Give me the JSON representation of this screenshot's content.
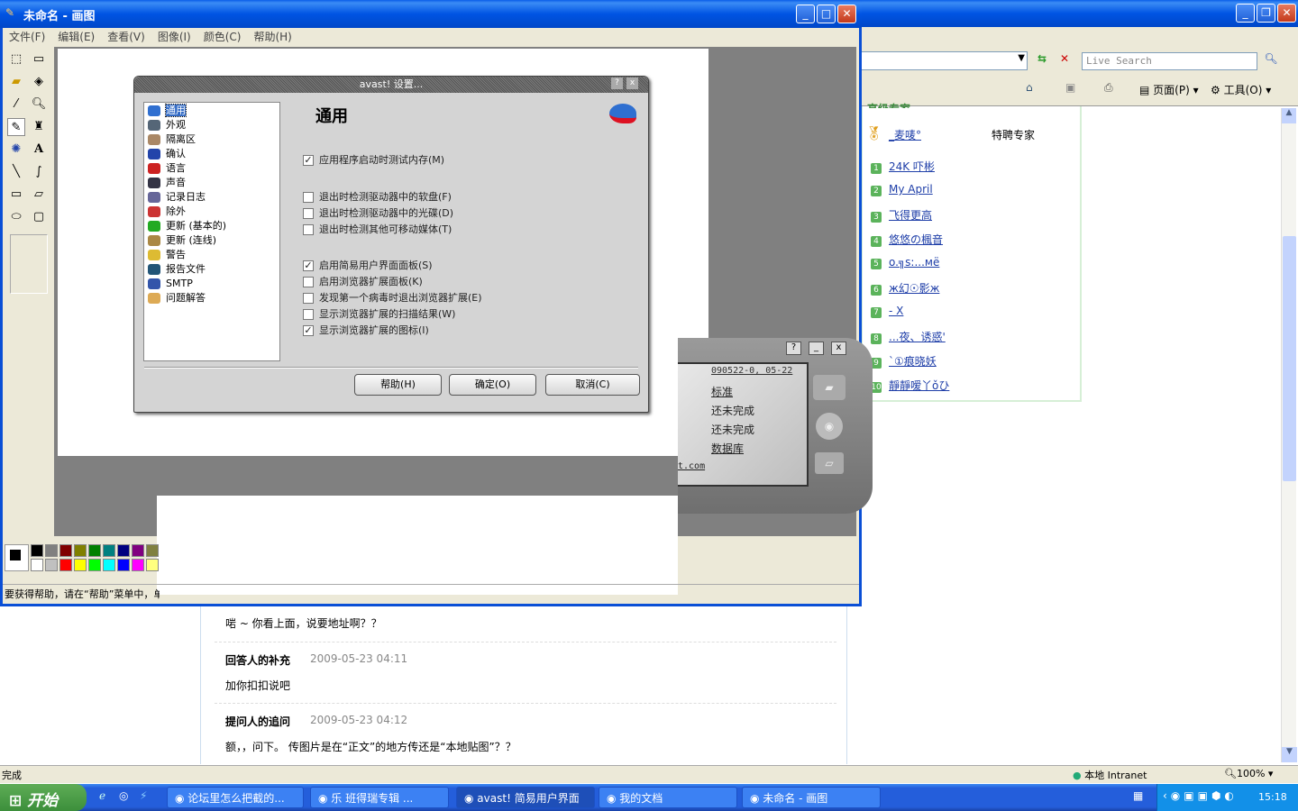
{
  "ie": {
    "live_search_placeholder": "Live Search",
    "page_menu": "页面(P)",
    "tools_menu": "工具(O)",
    "status_done": "完成",
    "zone": "本地 Intranet",
    "zoom": "100%",
    "ranking": {
      "partial_heading": "高级专家",
      "top_user": "_麦唛°",
      "top_role": "特聘专家",
      "items": [
        {
          "n": "1",
          "name": "24K 吓彬"
        },
        {
          "n": "2",
          "name": "My April"
        },
        {
          "n": "3",
          "name": "飞得更高"
        },
        {
          "n": "4",
          "name": "悠悠の楓音"
        },
        {
          "n": "5",
          "name": "o.╗s:...мё"
        },
        {
          "n": "6",
          "name": "ж幻☉影ж"
        },
        {
          "n": "7",
          "name": "- X"
        },
        {
          "n": "8",
          "name": "...夜、诱惑'"
        },
        {
          "n": "9",
          "name": "`①痕晓妖"
        },
        {
          "n": "10",
          "name": "靜靜嗳丫ǒひ"
        }
      ]
    },
    "thread": {
      "line0": "啱 ~ 你看上面，说要地址啊？？",
      "posts": [
        {
          "label": "回答人的补充",
          "time": "2009-05-23 04:11",
          "text": "加你扣扣说吧"
        },
        {
          "label": "提问人的追问",
          "time": "2009-05-23 04:12",
          "text": "额，，问下。 传图片是在“正文”的地方传还是“本地贴图”？？"
        }
      ]
    }
  },
  "paint": {
    "title": "未命名 - 画图",
    "menus": [
      "文件(F)",
      "编辑(E)",
      "查看(V)",
      "图像(I)",
      "颜色(C)",
      "帮助(H)"
    ],
    "status": "要获得帮助，请在“帮助”菜单中，单击“帮助主题”。",
    "palette_top": [
      "#000000",
      "#808080",
      "#800000",
      "#808000",
      "#008000",
      "#008080",
      "#000080",
      "#800080",
      "#808040"
    ],
    "palette_bottom": [
      "#ffffff",
      "#c0c0c0",
      "#ff0000",
      "#ffff00",
      "#00ff00",
      "#00ffff",
      "#0000ff",
      "#ff00ff",
      "#ffff80"
    ]
  },
  "avast": {
    "title": "avast! 设置...",
    "heading": "通用",
    "tree": [
      "通用",
      "外观",
      "隔离区",
      "确认",
      "语言",
      "声音",
      "记录日志",
      "除外",
      "更新 (基本的)",
      "更新 (连线)",
      "警告",
      "报告文件",
      "SMTP",
      "问题解答"
    ],
    "options": [
      {
        "label": "应用程序启动时测试内存(M)",
        "checked": true
      },
      {
        "label": "退出时检测驱动器中的软盘(F)",
        "checked": false
      },
      {
        "label": "退出时检测驱动器中的光碟(D)",
        "checked": false
      },
      {
        "label": "退出时检测其他可移动媒体(T)",
        "checked": false
      },
      {
        "label": "启用简易用户界面面板(S)",
        "checked": true
      },
      {
        "label": "启用浏览器扩展面板(K)",
        "checked": false
      },
      {
        "label": "发现第一个病毒时退出浏览器扩展(E)",
        "checked": false
      },
      {
        "label": "显示浏览器扩展的扫描结果(W)",
        "checked": false
      },
      {
        "label": "显示浏览器扩展的图标(I)",
        "checked": true
      }
    ],
    "help": "帮助(H)",
    "ok": "确定(O)",
    "cancel": "取消(C)"
  },
  "avast_ui": {
    "version": "090522-0, 05-22",
    "mode": "标准",
    "s1": "还未完成",
    "s2": "还未完成",
    "db": "数据库",
    "url": "t.com"
  },
  "taskbar": {
    "start": "开始",
    "tasks": [
      "论坛里怎么把截的...",
      "乐  班得瑞专辑 ...",
      "avast! 简易用户界面",
      "我的文档",
      "未命名 - 画图"
    ],
    "clock": "15:18"
  }
}
